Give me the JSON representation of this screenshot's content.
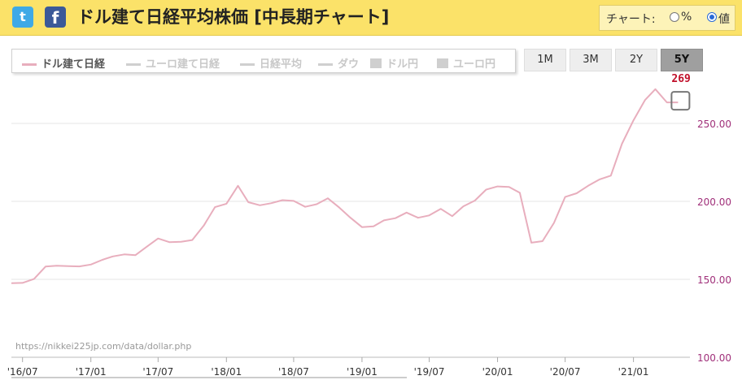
{
  "header": {
    "title": "ドル建て日経平均株価 [中長期チャート]",
    "twitter_icon": "twitter-icon",
    "facebook_icon": "facebook-icon",
    "chart_mode_label": "チャート:",
    "mode_options": [
      {
        "label": "%",
        "selected": false
      },
      {
        "label": "値",
        "selected": true
      }
    ]
  },
  "legend": {
    "items": [
      {
        "label": "ドル建て日経",
        "marker": "line",
        "active": true
      },
      {
        "label": "ユーロ建て日経",
        "marker": "line",
        "active": false
      },
      {
        "label": "日経平均",
        "marker": "line",
        "active": false
      },
      {
        "label": "ダウ",
        "marker": "line",
        "active": false
      },
      {
        "label": "ドル円",
        "marker": "box",
        "active": false
      },
      {
        "label": "ユーロ円",
        "marker": "box",
        "active": false
      }
    ]
  },
  "range_buttons": [
    {
      "label": "1M",
      "selected": false
    },
    {
      "label": "3M",
      "selected": false
    },
    {
      "label": "2Y",
      "selected": false
    },
    {
      "label": "5Y",
      "selected": true
    }
  ],
  "source_url": "https://nikkei225jp.com/data/dollar.php",
  "colors": {
    "series": "#e8aebd",
    "current_value": "#c0102a",
    "y_tick": "#a0307a"
  },
  "chart_data": {
    "type": "line",
    "current_value_label": "269",
    "ylim": [
      100,
      275
    ],
    "y_ticks": [
      100,
      150,
      200,
      250
    ],
    "y_tick_labels": [
      "100.00",
      "150.00",
      "200.00",
      "250.00"
    ],
    "x_ticks": [
      "2016-07",
      "2017-01",
      "2017-07",
      "2018-01",
      "2018-07",
      "2019-01",
      "2019-07",
      "2020-01",
      "2020-07",
      "2021-01"
    ],
    "x_tick_labels": [
      "'16/07",
      "'17/01",
      "'17/07",
      "'18/01",
      "'18/07",
      "'19/01",
      "'19/07",
      "'20/01",
      "'20/07",
      "'21/01"
    ],
    "series": [
      {
        "x": [
          "2016-06-01",
          "2016-07-01",
          "2016-08-01",
          "2016-09-01",
          "2016-10-01",
          "2016-11-01",
          "2016-12-01",
          "2017-01-01",
          "2017-02-01",
          "2017-03-01",
          "2017-04-01",
          "2017-05-01",
          "2017-06-01",
          "2017-07-01",
          "2017-08-01",
          "2017-09-01",
          "2017-10-01",
          "2017-11-01",
          "2017-12-01",
          "2018-01-01",
          "2018-02-01",
          "2018-03-01",
          "2018-04-01",
          "2018-05-01",
          "2018-06-01",
          "2018-07-01",
          "2018-08-01",
          "2018-09-01",
          "2018-10-01",
          "2018-11-01",
          "2018-12-01",
          "2019-01-01",
          "2019-02-01",
          "2019-03-01",
          "2019-04-01",
          "2019-05-01",
          "2019-06-01",
          "2019-07-01",
          "2019-08-01",
          "2019-09-01",
          "2019-10-01",
          "2019-11-01",
          "2019-12-01",
          "2020-01-01",
          "2020-02-01",
          "2020-03-01",
          "2020-04-01",
          "2020-05-01",
          "2020-06-01",
          "2020-07-01",
          "2020-08-01",
          "2020-09-01",
          "2020-10-01",
          "2020-11-01",
          "2020-12-01",
          "2021-01-01",
          "2021-02-01",
          "2021-03-01",
          "2021-04-01",
          "2021-05-01"
        ],
        "y": [
          147.5,
          147.7,
          150.2,
          158.2,
          158.7,
          158.5,
          158.3,
          159.5,
          162.5,
          164.7,
          166.0,
          165.5,
          171.0,
          176.2,
          173.8,
          174.1,
          175.2,
          184.5,
          196.3,
          198.5,
          210.0,
          199.5,
          197.5,
          198.8,
          200.8,
          200.3,
          196.5,
          198.2,
          202.0,
          196.0,
          189.5,
          183.5,
          184.0,
          187.8,
          189.2,
          192.8,
          189.5,
          191.0,
          195.2,
          190.5,
          196.8,
          200.5,
          207.5,
          209.6,
          209.2,
          205.5,
          173.5,
          174.5,
          186.2,
          202.8,
          205.2,
          210.0,
          214.0,
          216.5,
          237.0,
          252.0,
          265.0,
          272.0,
          263.5,
          263.5
        ]
      }
    ]
  }
}
